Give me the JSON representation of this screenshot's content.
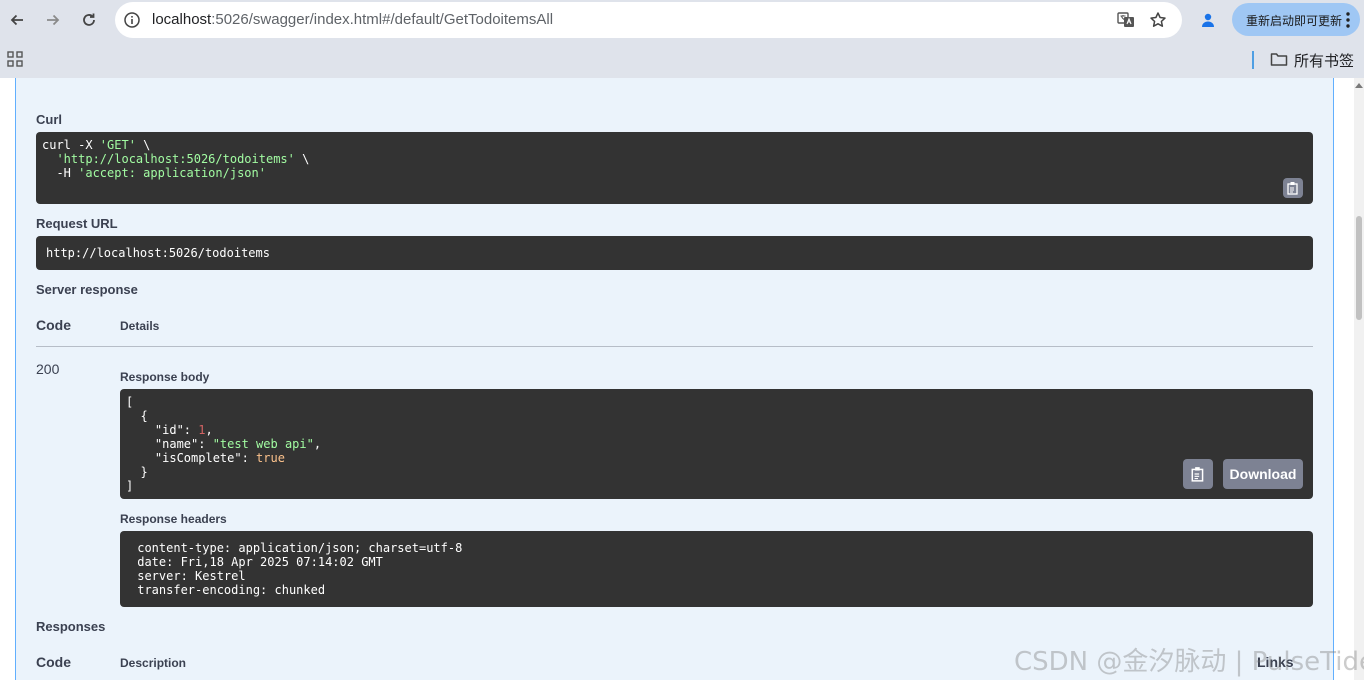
{
  "browser": {
    "url_host": "localhost",
    "url_rest": ":5026/swagger/index.html#/default/GetTodoitemsAll",
    "update_label": "重新启动即可更新",
    "bookmarks_label": "所有书签"
  },
  "curl": {
    "label": "Curl",
    "line1_cmd": "curl -X ",
    "line1_method": "'GET'",
    "line1_tail": " \\",
    "line2_indent": "  ",
    "line2_url": "'http://localhost:5026/todoitems'",
    "line2_tail": " \\",
    "line3_cmd": "  -H ",
    "line3_header": "'accept: application/json'"
  },
  "request_url": {
    "label": "Request URL",
    "value": "http://localhost:5026/todoitems"
  },
  "server_response": {
    "label": "Server response",
    "code_header": "Code",
    "details_header": "Details",
    "status_code": "200",
    "body_label": "Response body",
    "body": {
      "open_bracket": "[",
      "open_brace": "  {",
      "id_key": "    \"id\": ",
      "id_value": "1",
      "name_key": "    \"name\": ",
      "name_value": "\"test web api\"",
      "complete_key": "    \"isComplete\": ",
      "complete_value": "true",
      "close_brace": "  }",
      "close_bracket": "]"
    },
    "download_label": "Download",
    "headers_label": "Response headers",
    "headers": [
      " content-type: application/json; charset=utf-8 ",
      " date: Fri,18 Apr 2025 07:14:02 GMT ",
      " server: Kestrel ",
      " transfer-encoding: chunked "
    ]
  },
  "responses": {
    "label": "Responses",
    "code_header": "Code",
    "description_header": "Description",
    "links_header": "Links"
  },
  "watermark": "CSDN @金汐脉动 | PulseTide",
  "colors": {
    "accent": "#61affe",
    "panel_bg": "#ebf3fb",
    "code_bg": "#333333"
  },
  "icons": [
    "back-arrow-icon",
    "forward-arrow-icon",
    "reload-icon",
    "info-icon",
    "translate-icon",
    "star-icon",
    "profile-icon",
    "more-icon",
    "apps-icon",
    "folder-icon",
    "copy-icon"
  ]
}
